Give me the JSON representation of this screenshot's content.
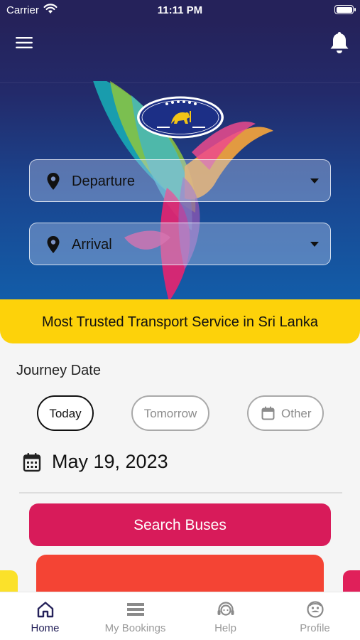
{
  "status_bar": {
    "carrier": "Carrier",
    "time": "11:11 PM"
  },
  "header": {
    "menu_icon": "hamburger-icon",
    "notification_icon": "bell-icon"
  },
  "brand": {
    "logo": "sltb-emblem",
    "logo_colors": [
      "#ffffff",
      "#1c2f86",
      "#f3c416"
    ]
  },
  "search_form": {
    "departure": {
      "label": "Departure",
      "icon": "location-pin-icon"
    },
    "arrival": {
      "label": "Arrival",
      "icon": "location-pin-icon"
    }
  },
  "banner": {
    "text": "Most Trusted Transport Service in Sri Lanka"
  },
  "journey": {
    "label": "Journey Date",
    "options": [
      {
        "label": "Today",
        "selected": true
      },
      {
        "label": "Tomorrow",
        "selected": false
      },
      {
        "label": "Other",
        "selected": false,
        "icon": "calendar-icon"
      }
    ],
    "selected_date": "May 19, 2023"
  },
  "search_button": {
    "label": "Search Buses"
  },
  "tabs": [
    {
      "label": "Home",
      "icon": "home-icon",
      "active": true
    },
    {
      "label": "My Bookings",
      "icon": "bookings-icon",
      "active": false
    },
    {
      "label": "Help",
      "icon": "headset-icon",
      "active": false
    },
    {
      "label": "Profile",
      "icon": "profile-icon",
      "active": false
    }
  ],
  "colors": {
    "header": "#25225a",
    "hero_bottom": "#125eaa",
    "banner": "#fdd20a",
    "search_button": "#d81b5a",
    "promo_red": "#f44434",
    "promo_yellow": "#fbe12a",
    "promo_pink": "#e0205a",
    "active_tab": "#25225a"
  }
}
